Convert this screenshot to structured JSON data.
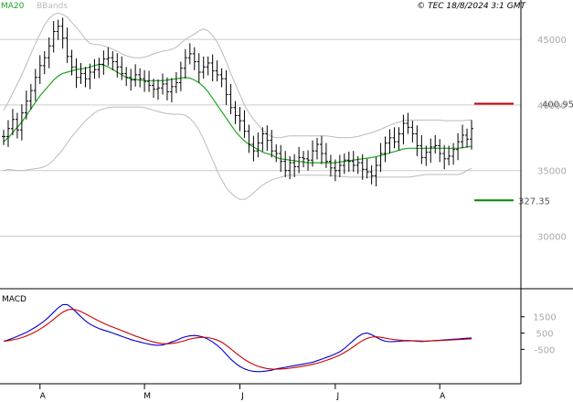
{
  "header": {
    "legend": [
      {
        "label": "MA20",
        "color": "#1fa51f"
      },
      {
        "label": "BBands",
        "color": "#bbbbbb"
      }
    ],
    "copyright": "© TEC 18/8/2024 3:1 GMT"
  },
  "macd_panel": {
    "title": "MACD"
  },
  "levels": [
    {
      "label": "400.95",
      "value": 40095,
      "color": "#cc0000"
    },
    {
      "label": "327.35",
      "value": 32735,
      "color": "#008800"
    }
  ],
  "colors": {
    "price_bars": "#000000",
    "ma20": "#1fa51f",
    "bbands": "#bbbbbb",
    "macd_line": "#0000cc",
    "signal_line": "#cc0000",
    "grid": "#cccccc"
  },
  "chart_data": [
    {
      "type": "ohlc",
      "title": "",
      "y_axis_ticks": [
        {
          "label": "45000",
          "value": 45000
        },
        {
          "label": "40000",
          "value": 40000
        },
        {
          "label": "35000",
          "value": 35000
        },
        {
          "label": "30000",
          "value": 30000
        }
      ],
      "ylim": [
        26000,
        48000
      ],
      "x_axis_ticks": [
        {
          "label": "A",
          "index": 8
        },
        {
          "label": "M",
          "index": 31
        },
        {
          "label": "J",
          "index": 52
        },
        {
          "label": "J",
          "index": 73
        },
        {
          "label": "A",
          "index": 96
        }
      ],
      "bar_count": 104,
      "price_close": [
        37600,
        38200,
        38900,
        38100,
        39400,
        40300,
        41100,
        42100,
        43000,
        43600,
        44500,
        45600,
        46000,
        45100,
        43700,
        42900,
        42100,
        42400,
        42000,
        42500,
        42700,
        43100,
        43500,
        43600,
        43300,
        42900,
        42400,
        42100,
        41900,
        42300,
        42000,
        41800,
        41500,
        41200,
        41300,
        41600,
        41000,
        41400,
        41700,
        42800,
        43600,
        43900,
        43300,
        42500,
        42900,
        43200,
        42600,
        42300,
        42000,
        40800,
        39800,
        39200,
        38800,
        38000,
        37000,
        36500,
        37100,
        37800,
        37300,
        36500,
        36300,
        35700,
        35000,
        35600,
        35300,
        36000,
        35900,
        35800,
        36500,
        37000,
        36300,
        35700,
        35200,
        35000,
        35400,
        35800,
        35700,
        35400,
        35600,
        35100,
        34900,
        34600,
        35400,
        36300,
        37100,
        37500,
        37200,
        37800,
        38600,
        38300,
        37800,
        36900,
        36000,
        36400,
        36800,
        36900,
        36300,
        35900,
        36100,
        36600,
        37200,
        37700,
        37400,
        38200
      ],
      "ma20": [
        37200,
        37500,
        37900,
        38300,
        38700,
        39200,
        39700,
        40200,
        40700,
        41100,
        41500,
        41900,
        42200,
        42400,
        42500,
        42600,
        42700,
        42750,
        42800,
        42900,
        43000,
        43100,
        43050,
        42900,
        42700,
        42500,
        42300,
        42100,
        42000,
        41950,
        41900,
        41850,
        41850,
        41850,
        41850,
        41850,
        41900,
        41950,
        42000,
        42050,
        42100,
        42050,
        41900,
        41700,
        41400,
        41000,
        40500,
        40000,
        39500,
        39000,
        38500,
        38000,
        37600,
        37250,
        37000,
        36800,
        36600,
        36400,
        36300,
        36200,
        36000,
        35900,
        35850,
        35800,
        35750,
        35700,
        35650,
        35600,
        35600,
        35600,
        35600,
        35600,
        35600,
        35600,
        35650,
        35700,
        35750,
        35800,
        35850,
        35900,
        35950,
        36000,
        36050,
        36150,
        36250,
        36350,
        36450,
        36550,
        36650,
        36700,
        36700,
        36700,
        36700,
        36700,
        36700,
        36700,
        36700,
        36700,
        36700,
        36700,
        36700,
        36750,
        36800,
        36850
      ],
      "bb_upper": [
        39600,
        40200,
        40900,
        41600,
        42300,
        43100,
        43900,
        44700,
        45400,
        46100,
        46600,
        46900,
        47000,
        46900,
        46700,
        46300,
        45900,
        45500,
        45000,
        44700,
        44600,
        44600,
        44500,
        44400,
        44250,
        44100,
        43900,
        43750,
        43650,
        43600,
        43600,
        43650,
        43750,
        43900,
        44000,
        44100,
        44150,
        44250,
        44400,
        44700,
        45000,
        45200,
        45400,
        45650,
        45800,
        45650,
        45300,
        44800,
        44100,
        43300,
        42400,
        41600,
        40800,
        40000,
        39400,
        38900,
        38500,
        38100,
        37800,
        37600,
        37500,
        37500,
        37600,
        37650,
        37650,
        37650,
        37650,
        37650,
        37650,
        37650,
        37650,
        37650,
        37600,
        37550,
        37500,
        37500,
        37500,
        37550,
        37600,
        37700,
        37800,
        37900,
        38000,
        38150,
        38300,
        38450,
        38600,
        38700,
        38800,
        38850,
        38850,
        38850,
        38850,
        38850,
        38850,
        38850,
        38850,
        38800,
        38800,
        38800,
        38800,
        38800,
        38850,
        38850
      ],
      "bb_lower": [
        35000,
        35100,
        35050,
        35000,
        35000,
        35050,
        35100,
        35150,
        35200,
        35300,
        35500,
        35800,
        36200,
        36600,
        37100,
        37600,
        38000,
        38400,
        38800,
        39100,
        39400,
        39600,
        39700,
        39800,
        39850,
        39850,
        39850,
        39850,
        39850,
        39850,
        39850,
        39800,
        39700,
        39600,
        39500,
        39400,
        39350,
        39300,
        39300,
        39300,
        39200,
        39000,
        38600,
        38100,
        37400,
        36600,
        35800,
        35000,
        34300,
        33700,
        33300,
        33000,
        32800,
        32800,
        33000,
        33300,
        33600,
        33900,
        34100,
        34300,
        34400,
        34500,
        34600,
        34650,
        34650,
        34650,
        34650,
        34650,
        34650,
        34650,
        34650,
        34650,
        34600,
        34600,
        34550,
        34550,
        34500,
        34500,
        34500,
        34500,
        34500,
        34500,
        34500,
        34500,
        34500,
        34500,
        34500,
        34500,
        34500,
        34500,
        34550,
        34600,
        34650,
        34700,
        34700,
        34700,
        34700,
        34700,
        34700,
        34700,
        34700,
        34800,
        35000,
        35200
      ]
    },
    {
      "type": "line",
      "title": "MACD",
      "y_axis_ticks": [
        {
          "label": "1500",
          "value": 1500
        },
        {
          "label": "500",
          "value": 500
        },
        {
          "label": "-500",
          "value": -500
        }
      ],
      "ylim": [
        -2500,
        3000
      ],
      "series": [
        {
          "name": "MACD",
          "color": "#0000cc",
          "values": [
            0,
            80,
            180,
            300,
            420,
            540,
            700,
            860,
            1050,
            1250,
            1500,
            1780,
            2050,
            2250,
            2250,
            2050,
            1780,
            1500,
            1250,
            1050,
            900,
            780,
            680,
            600,
            500,
            400,
            300,
            200,
            100,
            20,
            -50,
            -120,
            -180,
            -230,
            -250,
            -230,
            -150,
            -50,
            50,
            180,
            270,
            330,
            350,
            320,
            250,
            120,
            -50,
            -250,
            -500,
            -800,
            -1100,
            -1350,
            -1550,
            -1700,
            -1800,
            -1850,
            -1870,
            -1860,
            -1820,
            -1780,
            -1700,
            -1650,
            -1600,
            -1550,
            -1500,
            -1450,
            -1400,
            -1350,
            -1300,
            -1200,
            -1100,
            -1000,
            -900,
            -780,
            -650,
            -450,
            -200,
            50,
            280,
            450,
            500,
            400,
            250,
            100,
            0,
            -30,
            -20,
            0,
            20,
            30,
            20,
            0,
            -20,
            0,
            20,
            40,
            60,
            80,
            100,
            120,
            140,
            160,
            180,
            200
          ]
        },
        {
          "name": "Signal",
          "color": "#cc0000",
          "values": [
            0,
            30,
            80,
            140,
            220,
            320,
            440,
            580,
            740,
            920,
            1120,
            1350,
            1580,
            1780,
            1920,
            1970,
            1930,
            1820,
            1680,
            1530,
            1380,
            1240,
            1100,
            980,
            870,
            760,
            650,
            540,
            430,
            320,
            220,
            120,
            30,
            -50,
            -110,
            -150,
            -160,
            -140,
            -100,
            -30,
            50,
            130,
            190,
            230,
            240,
            220,
            160,
            70,
            -60,
            -250,
            -470,
            -700,
            -920,
            -1120,
            -1290,
            -1430,
            -1540,
            -1620,
            -1680,
            -1710,
            -1720,
            -1710,
            -1690,
            -1660,
            -1620,
            -1580,
            -1530,
            -1480,
            -1420,
            -1350,
            -1270,
            -1180,
            -1080,
            -970,
            -850,
            -700,
            -530,
            -340,
            -140,
            40,
            170,
            250,
            270,
            240,
            190,
            140,
            100,
            70,
            50,
            40,
            30,
            20,
            10,
            10,
            20,
            30,
            40,
            55,
            70,
            85,
            100,
            115,
            130,
            145
          ]
        }
      ],
      "x_axis_ticks": [
        {
          "label": "A",
          "index": 8
        },
        {
          "label": "M",
          "index": 31
        },
        {
          "label": "J",
          "index": 52
        },
        {
          "label": "J",
          "index": 73
        },
        {
          "label": "A",
          "index": 96
        }
      ]
    }
  ]
}
